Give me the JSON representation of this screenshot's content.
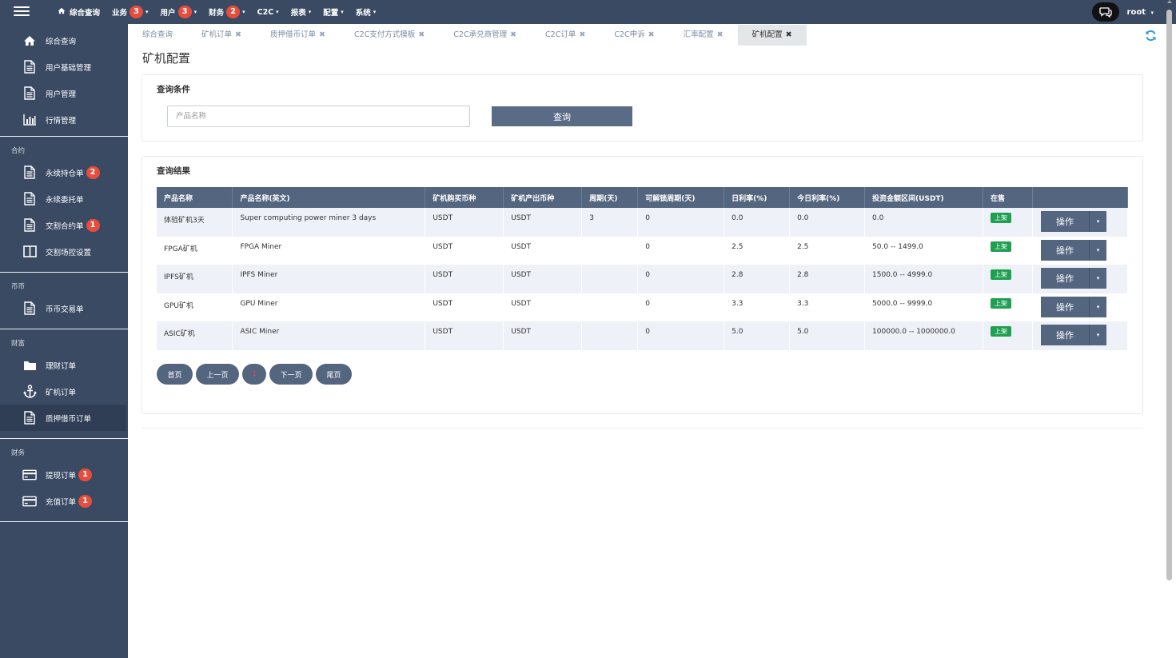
{
  "topbar": {
    "nav": [
      {
        "label": "综合查询",
        "badge": null,
        "icon": "home-icon"
      },
      {
        "label": "业务",
        "badge": "3"
      },
      {
        "label": "用户",
        "badge": "3"
      },
      {
        "label": "财务",
        "badge": "2"
      },
      {
        "label": "C2C",
        "badge": null
      },
      {
        "label": "报表",
        "badge": null
      },
      {
        "label": "配置",
        "badge": null
      },
      {
        "label": "系统",
        "badge": null
      }
    ],
    "user": "root",
    "caret": "▾"
  },
  "sidebar": {
    "groups": [
      {
        "head": "",
        "items": [
          {
            "label": "综合查询",
            "icon": "home-icon",
            "badge": null
          },
          {
            "label": "用户基础管理",
            "icon": "document-icon",
            "badge": null
          },
          {
            "label": "用户管理",
            "icon": "document-icon",
            "badge": null
          },
          {
            "label": "行情管理",
            "icon": "bar-chart-icon",
            "badge": null
          }
        ]
      },
      {
        "head": "合约",
        "items": [
          {
            "label": "永续持仓单",
            "icon": "document-icon",
            "badge": "2"
          },
          {
            "label": "永续委托单",
            "icon": "document-icon",
            "badge": null
          },
          {
            "label": "交割合约单",
            "icon": "document-icon",
            "badge": "1"
          },
          {
            "label": "交割场控设置",
            "icon": "columns-icon",
            "badge": null
          }
        ]
      },
      {
        "head": "币币",
        "items": [
          {
            "label": "币币交易单",
            "icon": "document-icon",
            "badge": null
          }
        ]
      },
      {
        "head": "财富",
        "items": [
          {
            "label": "理财订单",
            "icon": "folder-icon",
            "badge": null
          },
          {
            "label": "矿机订单",
            "icon": "anchor-icon",
            "badge": null
          },
          {
            "label": "质押借币订单",
            "icon": "document-icon",
            "badge": null,
            "active": true
          }
        ]
      },
      {
        "head": "财务",
        "items": [
          {
            "label": "提现订单",
            "icon": "card-icon",
            "badge": "1"
          },
          {
            "label": "充值订单",
            "icon": "card-icon",
            "badge": "1"
          }
        ]
      }
    ]
  },
  "tabs": [
    {
      "label": "综合查询",
      "closable": false
    },
    {
      "label": "矿机订单",
      "closable": true
    },
    {
      "label": "质押借币订单",
      "closable": true
    },
    {
      "label": "C2C支付方式模板",
      "closable": true
    },
    {
      "label": "C2C承兑商管理",
      "closable": true
    },
    {
      "label": "C2C订单",
      "closable": true
    },
    {
      "label": "C2C申诉",
      "closable": true
    },
    {
      "label": "汇率配置",
      "closable": true
    },
    {
      "label": "矿机配置",
      "closable": true,
      "active": true
    }
  ],
  "tab_close_glyph": "✖",
  "page_title": "矿机配置",
  "query": {
    "title": "查询条件",
    "placeholder": "产品名称",
    "value": "",
    "button": "查询"
  },
  "results": {
    "title": "查询结果",
    "columns": [
      "产品名称",
      "产品名称(英文)",
      "矿机购买币种",
      "矿机产出币种",
      "周期(天)",
      "可解锁周期(天)",
      "日利率(%)",
      "今日利率(%)",
      "投资金额区间(USDT)",
      "在售",
      ""
    ],
    "rows": [
      [
        "体验矿机3天",
        "Super computing power miner 3 days",
        "USDT",
        "USDT",
        "3",
        "0",
        "0.0",
        "0.0",
        "0.0",
        "上架",
        "操作"
      ],
      [
        "FPGA矿机",
        "FPGA Miner",
        "USDT",
        "USDT",
        "",
        "0",
        "2.5",
        "2.5",
        "50.0 -- 1499.0",
        "上架",
        "操作"
      ],
      [
        "IPFS矿机",
        "IPFS Miner",
        "USDT",
        "USDT",
        "",
        "0",
        "2.8",
        "2.8",
        "1500.0 -- 4999.0",
        "上架",
        "操作"
      ],
      [
        "GPU矿机",
        "GPU Miner",
        "USDT",
        "USDT",
        "",
        "0",
        "3.3",
        "3.3",
        "5000.0 -- 9999.0",
        "上架",
        "操作"
      ],
      [
        "ASIC矿机",
        "ASIC Miner",
        "USDT",
        "USDT",
        "",
        "0",
        "5.0",
        "5.0",
        "100000.0 -- 1000000.0",
        "上架",
        "操作"
      ]
    ]
  },
  "pager": {
    "first": "首页",
    "prev": "上一页",
    "current": "1",
    "next": "下一页",
    "last": "尾页"
  },
  "colors": {
    "topbar": "#3a4a63",
    "table_header": "#54657f",
    "badge": "#e74c3c",
    "status_on": "#1ea052",
    "refresh": "#3a9ad9"
  }
}
